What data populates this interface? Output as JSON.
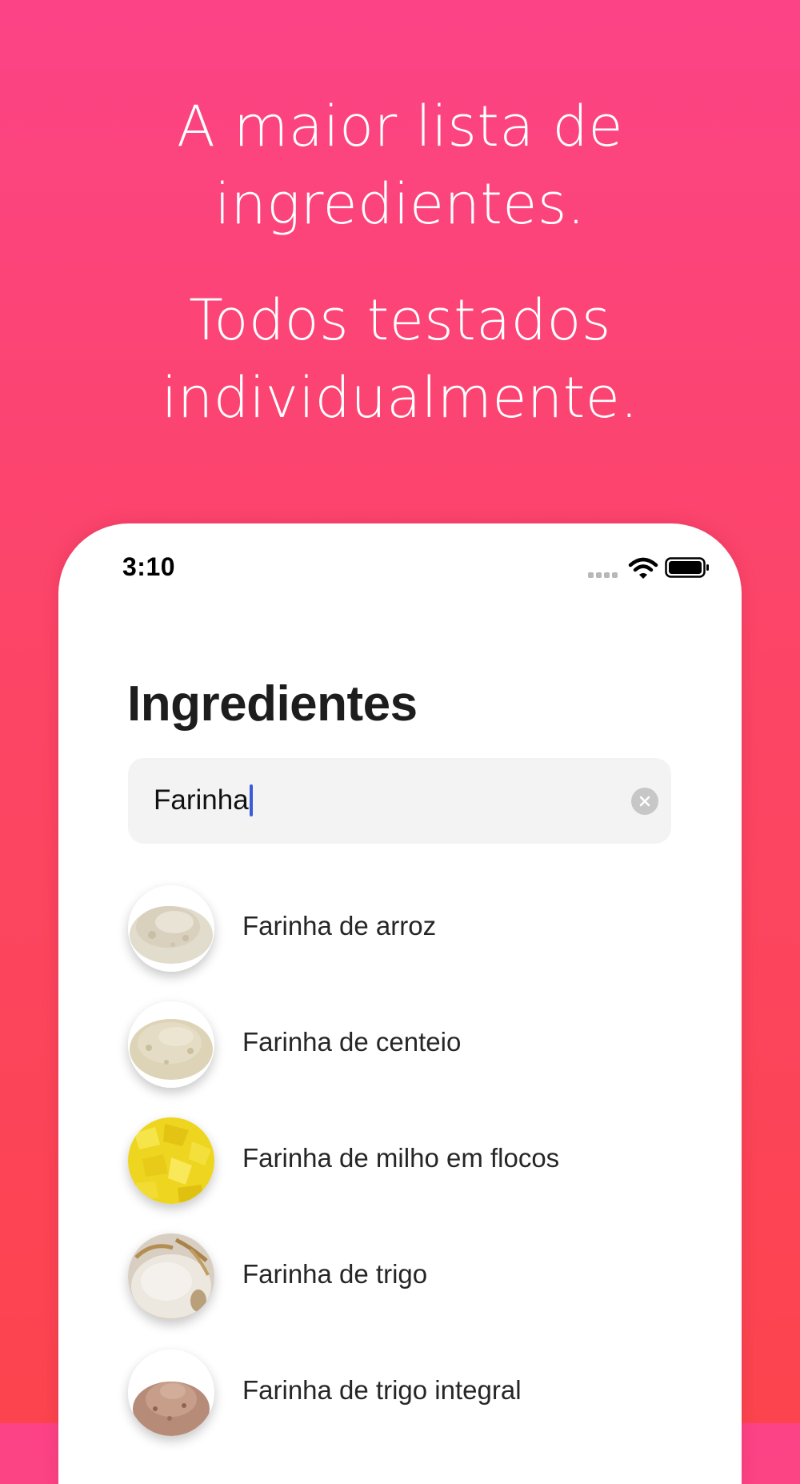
{
  "headline": {
    "line1": "A maior lista de",
    "line2": "ingredientes.",
    "line3": "Todos testados",
    "line4": "individualmente."
  },
  "status_bar": {
    "time": "3:10",
    "icons": [
      "signal-icon",
      "wifi-icon",
      "battery-icon"
    ]
  },
  "screen": {
    "title": "Ingredientes",
    "search": {
      "value": "Farinha",
      "clear_icon": "clear-icon"
    },
    "results": [
      {
        "label": "Farinha de arroz",
        "image": "rice-flour-image"
      },
      {
        "label": "Farinha de centeio",
        "image": "rye-flour-image"
      },
      {
        "label": "Farinha de milho em flocos",
        "image": "corn-flakes-flour-image"
      },
      {
        "label": "Farinha de trigo",
        "image": "wheat-flour-image"
      },
      {
        "label": "Farinha de trigo integral",
        "image": "whole-wheat-flour-image"
      }
    ]
  },
  "colors": {
    "background_top": "#FC4386",
    "background_bottom": "#FC444E",
    "cursor": "#3B5BDB",
    "search_background": "#F3F3F3"
  }
}
